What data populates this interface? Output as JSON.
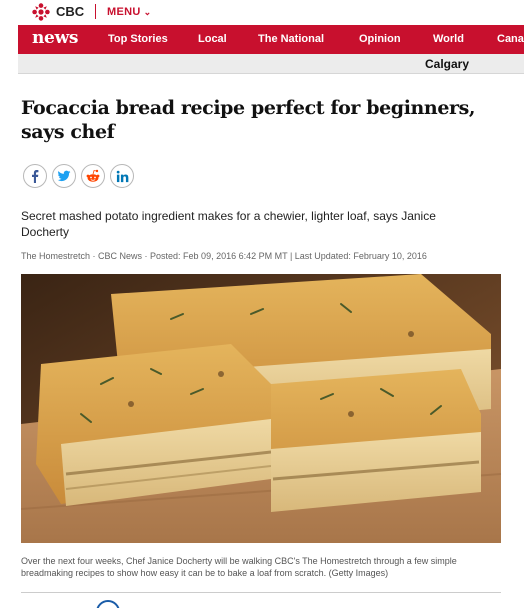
{
  "topbar": {
    "brand": "CBC",
    "menu_label": "MENU",
    "menu_chevron": "chevron-down-icon"
  },
  "nav": {
    "logo": "news",
    "links": [
      "Top Stories",
      "Local",
      "The National",
      "Opinion",
      "World",
      "Canada"
    ],
    "region": "Calgary"
  },
  "article": {
    "headline": "Focaccia bread recipe perfect for beginners, says chef",
    "share_icons": [
      "facebook-icon",
      "twitter-icon",
      "reddit-icon",
      "linkedin-icon"
    ],
    "deck": "Secret mashed potato ingredient makes for a chewier, lighter loaf, says Janice Docherty",
    "byline": "The Homestretch · CBC News · Posted: Feb 09, 2016 6:42 PM MT | Last Updated: February 10, 2016",
    "caption": "Over the next four weeks, Chef Janice Docherty will be walking CBC's The Homestretch through a few simple breadmaking recipes to show how easy it can be to bake a loaf from scratch. (Getty Images)"
  },
  "colors": {
    "brand_red": "#c8102e",
    "region_bar": "#ececec",
    "link_blue": "#1a5ca8"
  }
}
